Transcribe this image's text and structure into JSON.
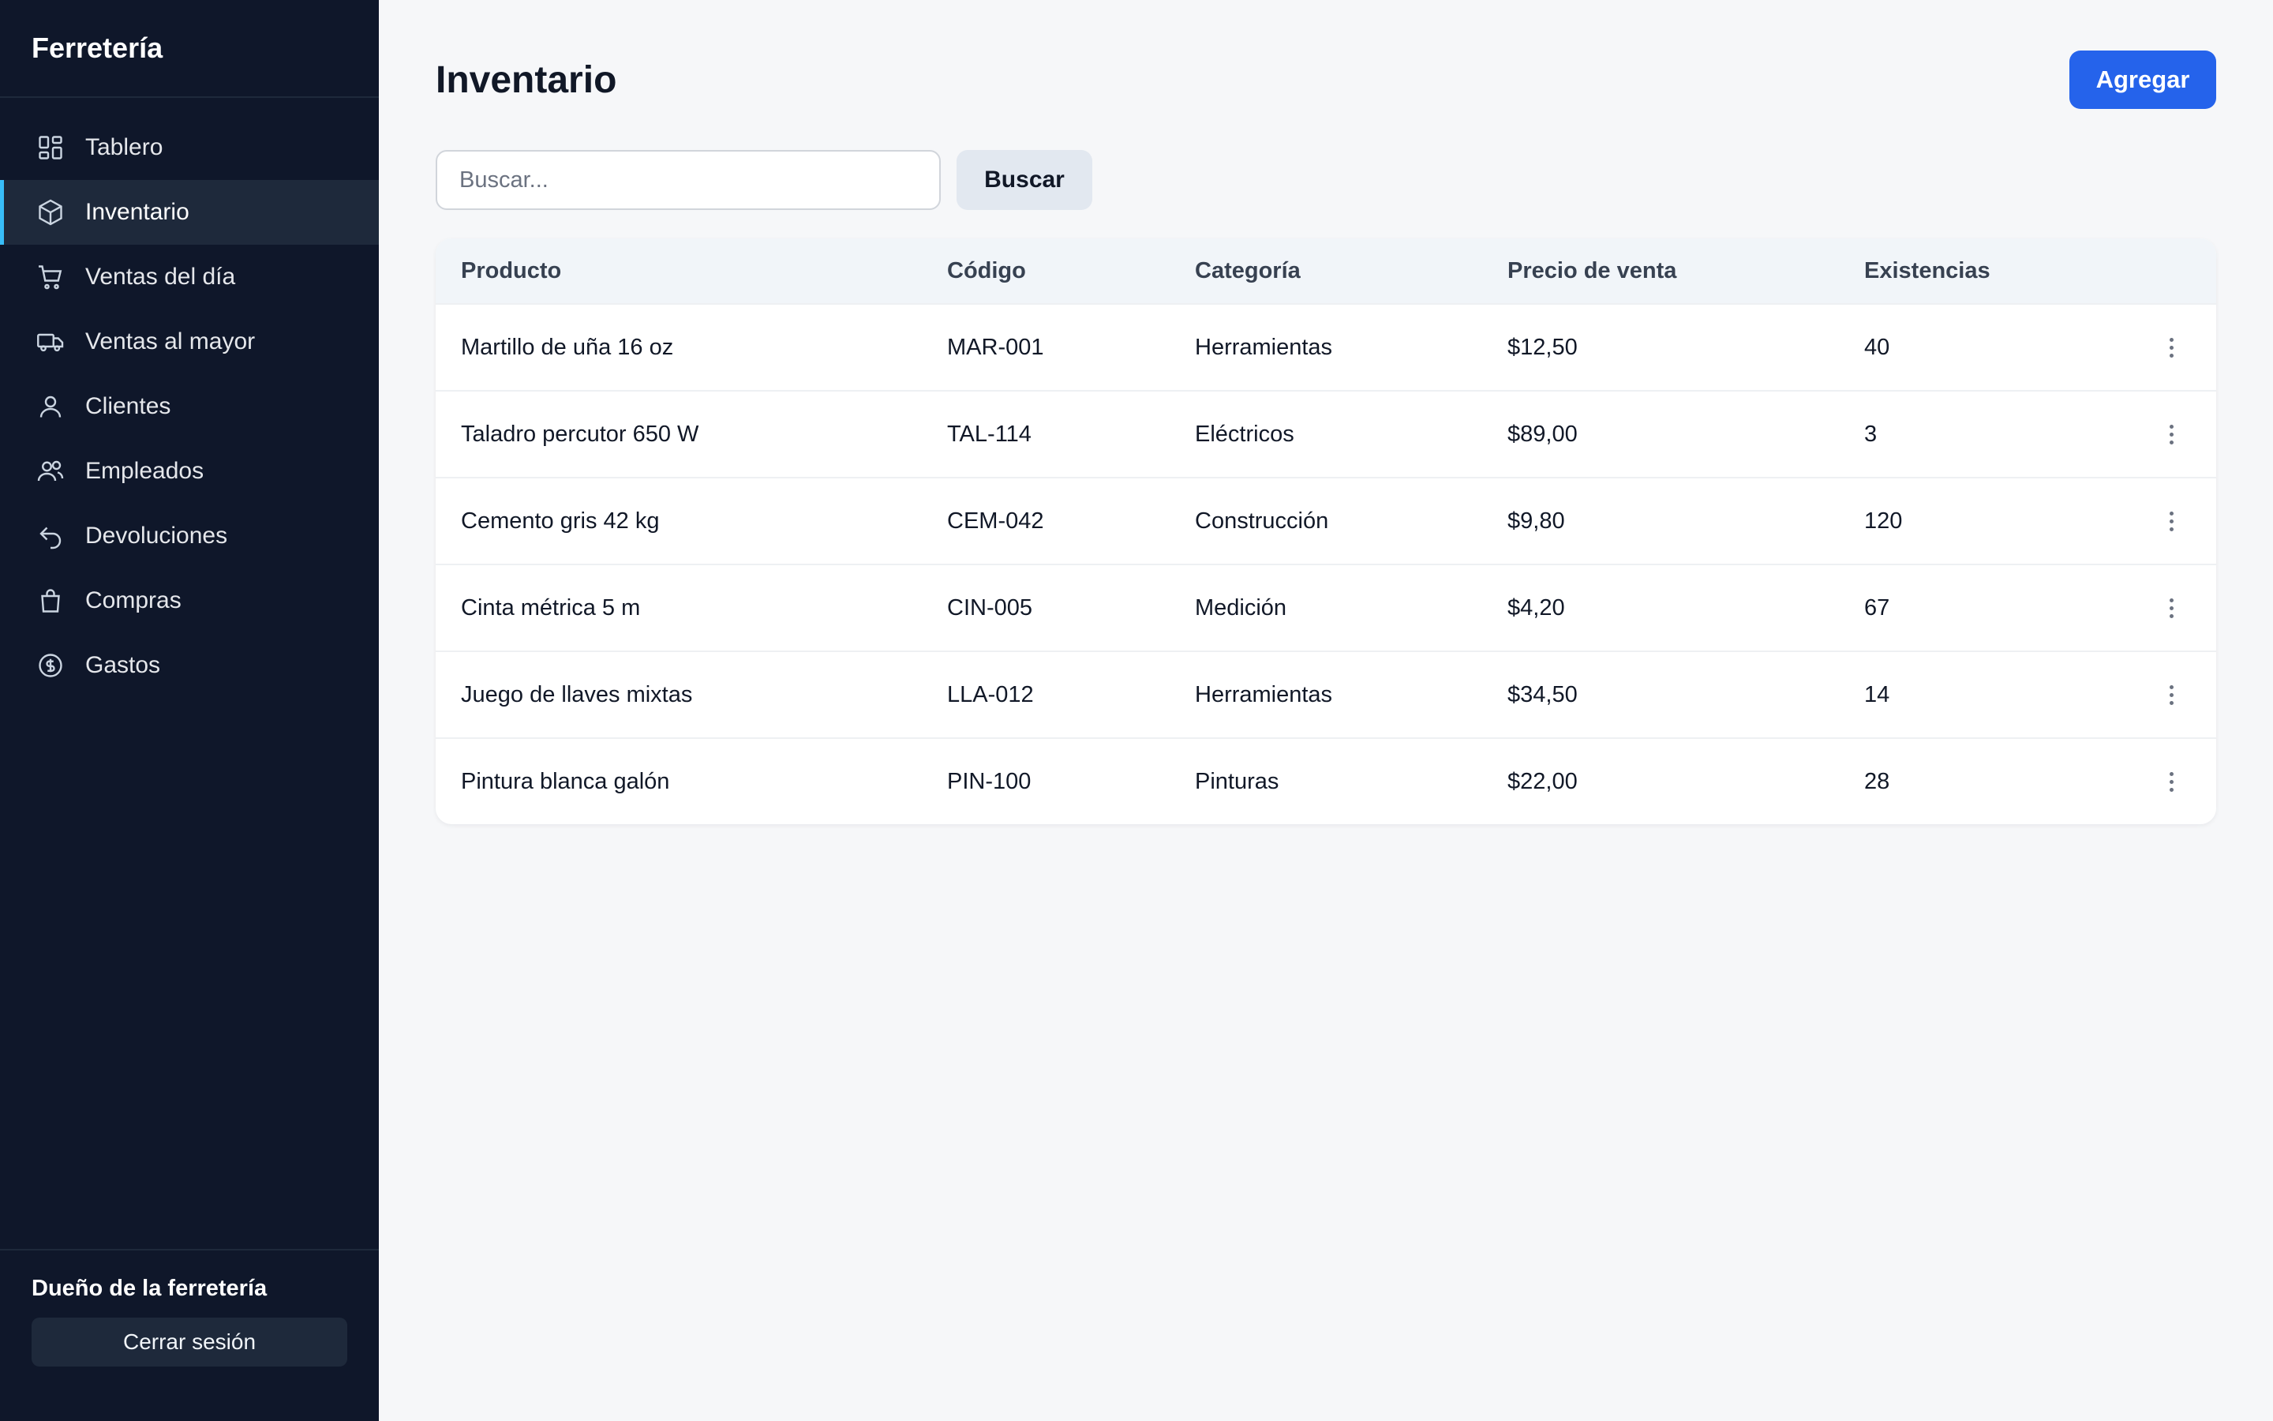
{
  "app": {
    "brand": "Ferretería"
  },
  "sidebar": {
    "items": [
      {
        "label": "Tablero",
        "icon": "dashboard-icon",
        "active": false
      },
      {
        "label": "Inventario",
        "icon": "box-icon",
        "active": true
      },
      {
        "label": "Ventas del día",
        "icon": "cart-icon",
        "active": false
      },
      {
        "label": "Ventas al mayor",
        "icon": "truck-icon",
        "active": false
      },
      {
        "label": "Clientes",
        "icon": "user-icon",
        "active": false
      },
      {
        "label": "Empleados",
        "icon": "users-icon",
        "active": false
      },
      {
        "label": "Devoluciones",
        "icon": "undo-icon",
        "active": false
      },
      {
        "label": "Compras",
        "icon": "bag-icon",
        "active": false
      },
      {
        "label": "Gastos",
        "icon": "coin-icon",
        "active": false
      }
    ],
    "footer": {
      "owner": "Dueño de la ferretería",
      "logout_label": "Cerrar sesión"
    }
  },
  "main": {
    "title": "Inventario",
    "add_label": "Agregar",
    "search": {
      "placeholder": "Buscar...",
      "value": "",
      "button_label": "Buscar"
    },
    "table": {
      "headers": {
        "product": "Producto",
        "code": "Código",
        "category": "Categoría",
        "price": "Precio de venta",
        "stock": "Existencias"
      },
      "rows": [
        {
          "product": "Martillo de uña 16 oz",
          "code": "MAR-001",
          "category": "Herramientas",
          "price": "$12,50",
          "stock": "40"
        },
        {
          "product": "Taladro percutor 650 W",
          "code": "TAL-114",
          "category": "Eléctricos",
          "price": "$89,00",
          "stock": "3"
        },
        {
          "product": "Cemento gris 42 kg",
          "code": "CEM-042",
          "category": "Construcción",
          "price": "$9,80",
          "stock": "120"
        },
        {
          "product": "Cinta métrica 5 m",
          "code": "CIN-005",
          "category": "Medición",
          "price": "$4,20",
          "stock": "67"
        },
        {
          "product": "Juego de llaves mixtas",
          "code": "LLA-012",
          "category": "Herramientas",
          "price": "$34,50",
          "stock": "14"
        },
        {
          "product": "Pintura blanca galón",
          "code": "PIN-100",
          "category": "Pinturas",
          "price": "$22,00",
          "stock": "28"
        }
      ]
    }
  },
  "colors": {
    "sidebar_bg": "#0f172a",
    "active_accent": "#38bdf8",
    "primary": "#2563eb",
    "page_bg": "#f6f7f9"
  }
}
